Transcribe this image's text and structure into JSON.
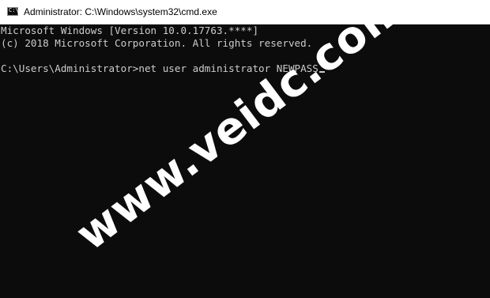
{
  "window": {
    "title": "Administrator: C:\\Windows\\system32\\cmd.exe",
    "icon": "cmd-console-icon"
  },
  "console": {
    "lines": [
      "Microsoft Windows [Version 10.0.17763.****]",
      "(c) 2018 Microsoft Corporation. All rights reserved.",
      "C:\\Users\\Administrator>net user administrator NEWPASS"
    ]
  },
  "watermark": {
    "text": "www.veidc.com"
  },
  "colors": {
    "console_bg": "#0c0c0c",
    "console_text": "#cccccc",
    "titlebar_bg": "#ffffff"
  }
}
